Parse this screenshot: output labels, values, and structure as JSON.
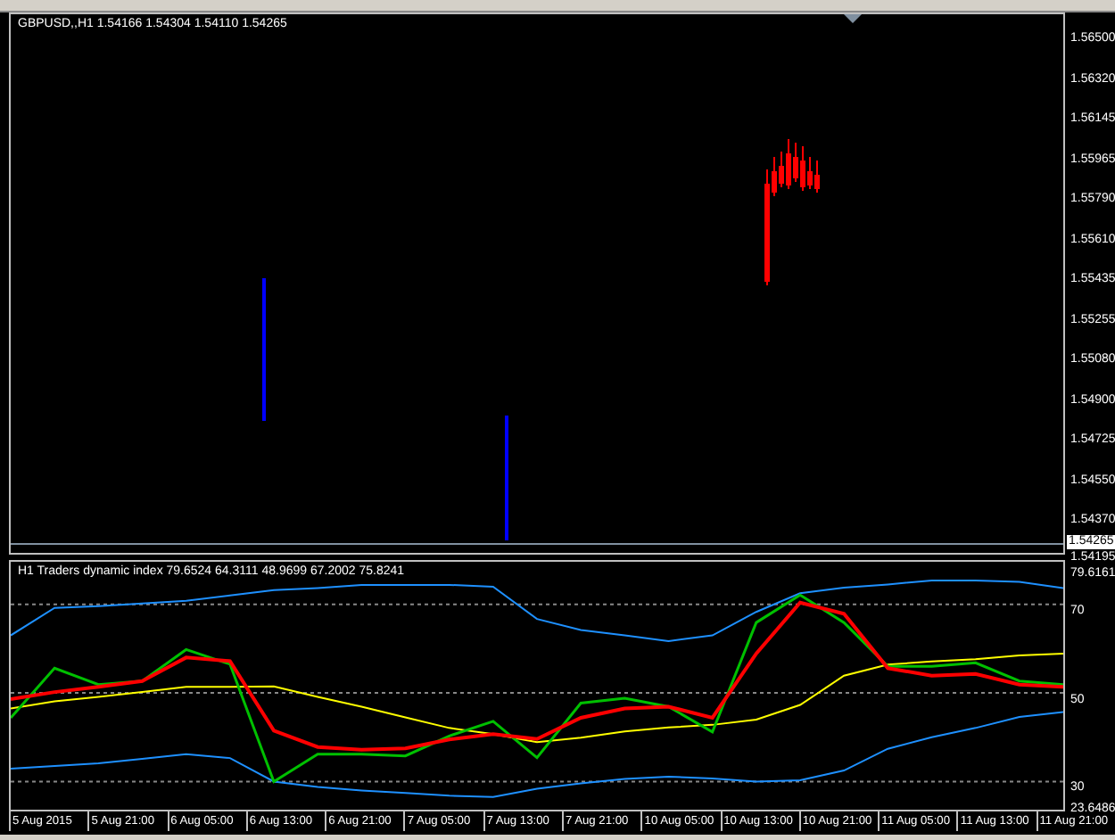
{
  "main_chart": {
    "header": "GBPUSD,,H1  1.54166 1.54304 1.54110 1.54265",
    "price_axis": [
      "1.56500",
      "1.56320",
      "1.56145",
      "1.55965",
      "1.55790",
      "1.55610",
      "1.55435",
      "1.55255",
      "1.55080",
      "1.54900",
      "1.54725",
      "1.54550",
      "1.54370"
    ],
    "current_price": "1.54265",
    "last_label": "1.54195"
  },
  "indicator": {
    "header": "H1 Traders dynamic index 79.6524 64.3111 48.9699 67.2002 75.8241",
    "chart_data": {
      "type": "line",
      "grid": true,
      "ylim": [
        23.6486,
        79.6161
      ],
      "yticks": [
        {
          "value": 30,
          "label": "30"
        },
        {
          "value": 50,
          "label": "50"
        },
        {
          "value": 70,
          "label": "70"
        }
      ],
      "series": [
        {
          "color": "#1e90ff",
          "values": [
            63.0,
            69.2,
            69.6,
            70.2,
            70.8,
            72.0,
            73.2,
            73.7,
            74.4,
            74.4,
            74.4,
            74.0,
            66.7,
            64.2,
            63.0,
            61.7,
            63.0,
            68.3,
            72.5,
            73.8,
            74.5,
            75.4,
            75.4,
            75.1,
            73.7
          ]
        },
        {
          "color": "#1e90ff",
          "values": [
            32.9,
            33.5,
            34.1,
            35.1,
            36.2,
            35.3,
            30.0,
            28.8,
            28.0,
            27.4,
            26.8,
            26.5,
            28.4,
            29.6,
            30.6,
            31.1,
            30.7,
            30.0,
            30.3,
            32.5,
            37.4,
            40.0,
            42.1,
            44.6,
            45.7
          ]
        },
        {
          "color": "#ffff00",
          "values": [
            46.5,
            48.1,
            49.1,
            50.2,
            51.4,
            51.4,
            51.5,
            49.1,
            46.9,
            44.5,
            42.1,
            40.7,
            38.9,
            39.9,
            41.3,
            42.2,
            42.8,
            44.0,
            47.3,
            53.9,
            56.4,
            57.1,
            57.6,
            58.5,
            58.9
          ]
        },
        {
          "color": "#00c000",
          "values": [
            44.4,
            55.6,
            51.9,
            52.7,
            59.8,
            56.5,
            30.0,
            36.2,
            36.2,
            35.8,
            40.3,
            43.6,
            35.4,
            47.7,
            48.8,
            46.9,
            41.2,
            65.9,
            72.1,
            65.9,
            56.0,
            56.0,
            56.8,
            52.7,
            51.9
          ]
        },
        {
          "color": "#ff0000",
          "values": [
            48.6,
            50.2,
            51.4,
            52.7,
            58.0,
            57.2,
            41.5,
            37.8,
            37.2,
            37.5,
            39.5,
            40.7,
            39.6,
            44.4,
            46.5,
            46.9,
            44.4,
            58.9,
            70.4,
            67.9,
            55.6,
            53.9,
            54.3,
            51.9,
            51.4
          ]
        }
      ]
    },
    "axis": [
      {
        "label": "79.6161",
        "kind": "max"
      },
      {
        "label": "23.6486",
        "kind": "min"
      }
    ]
  },
  "time_axis": [
    "5 Aug 2015",
    "5 Aug 21:00",
    "6 Aug 05:00",
    "6 Aug 13:00",
    "6 Aug 21:00",
    "7 Aug 05:00",
    "7 Aug 13:00",
    "7 Aug 21:00",
    "10 Aug 05:00",
    "10 Aug 13:00",
    "10 Aug 21:00",
    "11 Aug 05:00",
    "11 Aug 13:00",
    "11 Aug 21:00"
  ]
}
